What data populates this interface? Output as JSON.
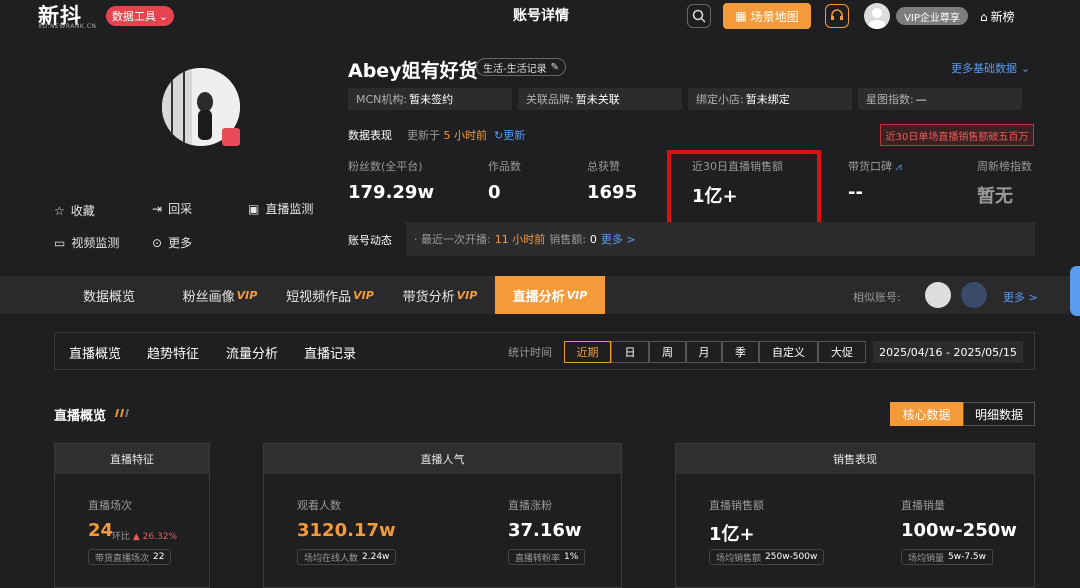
{
  "topbar": {
    "logo": "新抖",
    "logo_sub": "XD.NEWRANK.CN",
    "tool_button": "数据工具",
    "page_title": "账号详情",
    "scene_map": "场景地图",
    "vip_label": "VIP企业尊享",
    "new_rank": "新榜"
  },
  "profile": {
    "name": "Abey姐有好货",
    "category": "生活-生活记录",
    "more_basic": "更多基础数据",
    "actions": [
      "收藏",
      "回采",
      "直播监测",
      "视频监测",
      "更多"
    ],
    "info": [
      {
        "label": "MCN机构:",
        "value": "暂未签约"
      },
      {
        "label": "关联品牌:",
        "value": "暂未关联"
      },
      {
        "label": "绑定小店:",
        "value": "暂未绑定"
      },
      {
        "label": "星图指数:",
        "value": "—"
      }
    ],
    "perf_label": "数据表现",
    "updated_prefix": "更新于",
    "updated_time": "5 小时前",
    "refresh": "更新",
    "red_badge": "近30日单场直播销售额破五百万",
    "metrics": [
      {
        "label": "粉丝数(全平台)",
        "value": "179.29w"
      },
      {
        "label": "作品数",
        "value": "0"
      },
      {
        "label": "总获赞",
        "value": "1695"
      },
      {
        "label": "近30日直播销售额",
        "value": "1亿+"
      },
      {
        "label": "带货口碑",
        "value": "--"
      },
      {
        "label": "周新榜指数",
        "value": "暂无"
      }
    ],
    "dynamics_label": "账号动态",
    "dynamics": {
      "prefix": "· 最近一次开播:",
      "time": "11 小时前",
      "sales_label": "销售额:",
      "sales": "0",
      "more": "更多 >"
    }
  },
  "tabs": {
    "items": [
      {
        "label": "数据概览",
        "vip": ""
      },
      {
        "label": "粉丝画像",
        "vip": "VIP"
      },
      {
        "label": "短视频作品",
        "vip": "VIP"
      },
      {
        "label": "带货分析",
        "vip": "VIP"
      },
      {
        "label": "直播分析",
        "vip": "VIP"
      }
    ],
    "similar_label": "相似账号:",
    "more": "更多 >"
  },
  "subnav": {
    "items": [
      "直播概览",
      "趋势特征",
      "流量分析",
      "直播记录"
    ],
    "time_label": "统计时间",
    "periods": [
      "近期",
      "日",
      "周",
      "月",
      "季",
      "自定义",
      "大促"
    ],
    "date_range": "2025/04/16 - 2025/05/15"
  },
  "overview": {
    "title": "直播概览",
    "core_btn": "核心数据",
    "detail_btn": "明细数据",
    "card1": {
      "head": "直播特征",
      "label": "直播场次",
      "value": "24",
      "yoy_label": "环比",
      "yoy_value": "▲ 26.32%",
      "sub_label": "带货直播场次",
      "sub_value": "22"
    },
    "card2": {
      "head": "直播人气",
      "a_label": "观看人数",
      "a_value": "3120.17w",
      "a_sub_label": "场均在线人数",
      "a_sub_value": "2.24w",
      "b_label": "直播涨粉",
      "b_value": "37.16w",
      "b_sub_label": "直播转粉率",
      "b_sub_value": "1%"
    },
    "card3": {
      "head": "销售表现",
      "a_label": "直播销售额",
      "a_value": "1亿+",
      "a_sub_label": "场均销售额",
      "a_sub_value": "250w-500w",
      "b_label": "直播销量",
      "b_value": "100w-250w",
      "b_sub_label": "场均销量",
      "b_sub_value": "5w-7.5w"
    }
  },
  "colors": {
    "accent": "#f39a3a",
    "link": "#5a9bf0",
    "highlight": "#e00f0f",
    "bg": "#1f1f21"
  }
}
